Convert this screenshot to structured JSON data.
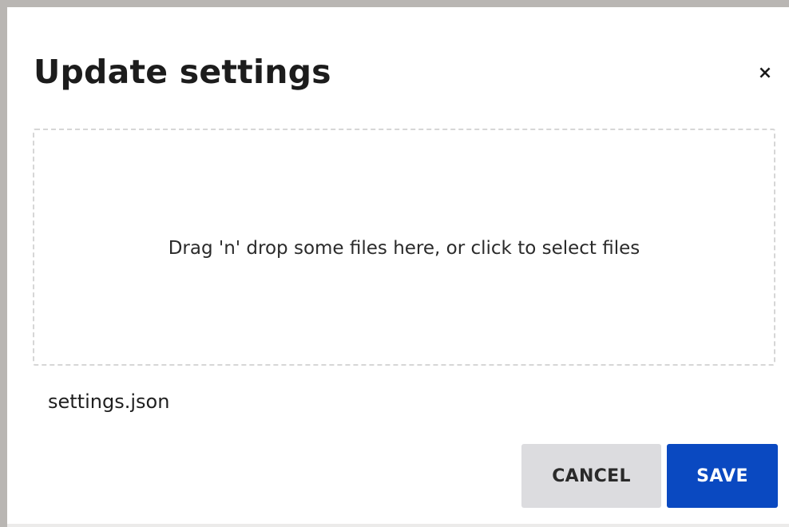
{
  "dialog": {
    "title": "Update settings",
    "close_icon": "close-icon",
    "close_glyph": "×",
    "dropzone": {
      "prompt": "Drag 'n' drop some files here, or click to select files"
    },
    "selected_file": "settings.json",
    "buttons": {
      "cancel_label": "CANCEL",
      "save_label": "SAVE"
    }
  },
  "colors": {
    "primary": "#0a49c1",
    "cancel_bg": "#dcdcdf",
    "dropzone_border": "#d6d6d6"
  }
}
